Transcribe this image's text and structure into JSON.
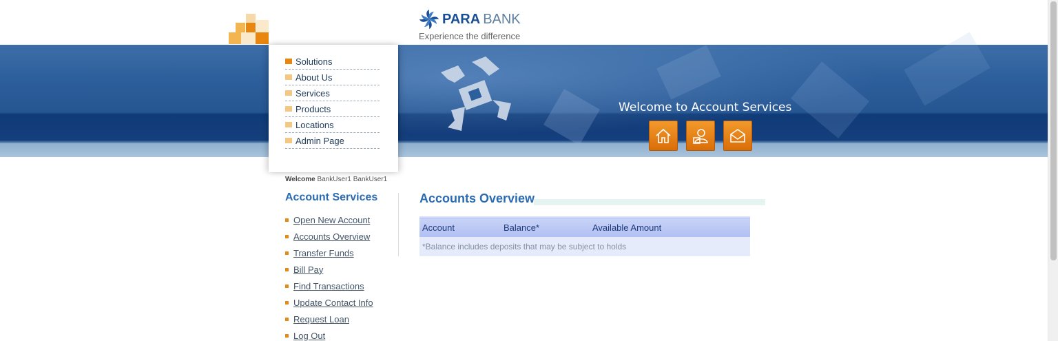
{
  "brand": {
    "name_bold": "PARA",
    "name_light": "BANK",
    "tagline": "Experience the difference"
  },
  "nav_menu": [
    {
      "label": "Solutions"
    },
    {
      "label": "About Us"
    },
    {
      "label": "Services"
    },
    {
      "label": "Products"
    },
    {
      "label": "Locations"
    },
    {
      "label": "Admin Page"
    }
  ],
  "banner": {
    "headline": "Welcome to Account Services",
    "icons": [
      "home-icon",
      "about-icon",
      "contact-icon"
    ]
  },
  "user": {
    "welcome_label": "Welcome",
    "full_name": "BankUser1 BankUser1"
  },
  "account_services": {
    "title": "Account Services",
    "links": [
      {
        "label": "Open New Account"
      },
      {
        "label": "Accounts Overview"
      },
      {
        "label": "Transfer Funds"
      },
      {
        "label": "Bill Pay"
      },
      {
        "label": "Find Transactions"
      },
      {
        "label": "Update Contact Info"
      },
      {
        "label": "Request Loan"
      },
      {
        "label": "Log Out"
      }
    ]
  },
  "overview": {
    "title": "Accounts Overview",
    "columns": [
      "Account",
      "Balance*",
      "Available Amount"
    ],
    "footnote": "*Balance includes deposits that may be subject to holds"
  },
  "colors": {
    "accent_orange": "#e8860e",
    "heading_blue": "#2a6bb1",
    "banner_blue": "#265692"
  }
}
